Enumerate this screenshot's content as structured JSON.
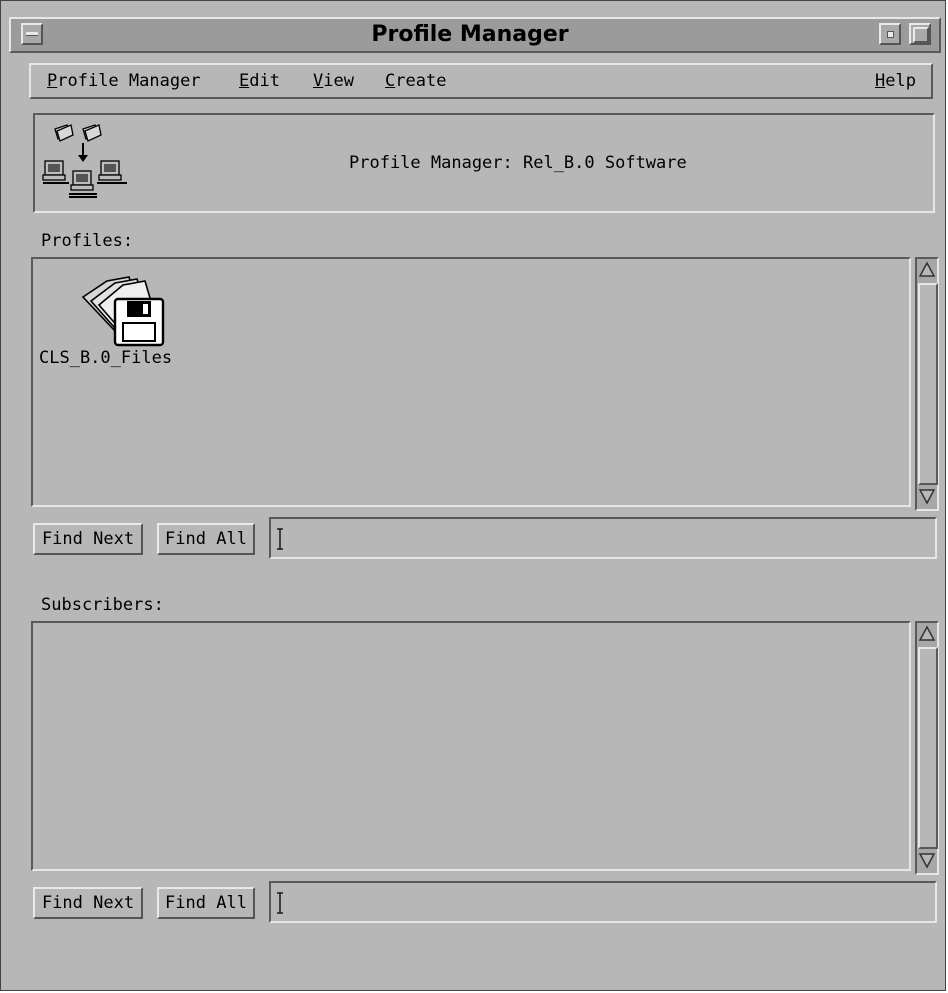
{
  "window": {
    "title": "Profile Manager"
  },
  "menubar": {
    "items": [
      "Profile Manager",
      "Edit",
      "View",
      "Create"
    ],
    "help": "Help"
  },
  "header": {
    "text": "Profile Manager: Rel_B.0 Software",
    "icon": "network-distribution-icon"
  },
  "profiles": {
    "label": "Profiles:",
    "items": [
      {
        "name": "CLS_B.0_Files",
        "icon": "file-package-icon"
      }
    ],
    "find_next": "Find Next",
    "find_all": "Find All",
    "search_value": ""
  },
  "subscribers": {
    "label": "Subscribers:",
    "items": [],
    "find_next": "Find Next",
    "find_all": "Find All",
    "search_value": ""
  }
}
